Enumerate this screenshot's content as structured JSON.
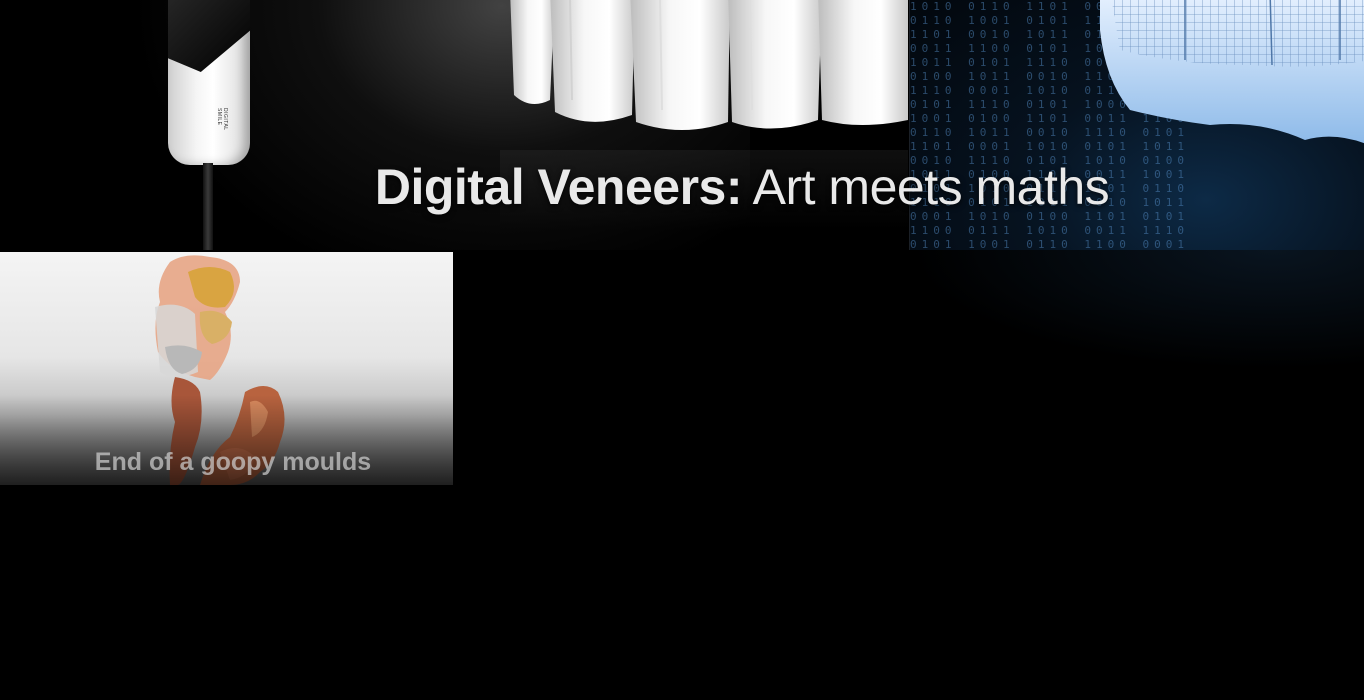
{
  "banner": {
    "title_bold": "Digital Veneers:",
    "title_regular": " Art meets maths",
    "scanner_logo": "DIGITAL SMILE",
    "binary_text": "1010 0110 1101 0011 1001\n0110 1001 0101 1100 0111\n1101 0010 1011 0110 1001\n0011 1100 0101 1010 0110\n1011 0101 1110 0001 1011\n0100 1011 0010 1101 0100\n1110 0001 1010 0111 1101\n0101 1110 0101 1000 0010\n1001 0100 1101 0011 1100\n0110 1011 0010 1110 0101\n1101 0001 1010 0101 1011\n0010 1110 0101 1010 0100\n1011 0100 1101 0011 1001\n0101 1010 0110 1101 0110\n1110 0101 1011 0010 1011\n0001 1010 0100 1101 0101\n1100 0111 1010 0011 1110\n0101 1001 0110 1100 0001"
  },
  "thumbnail": {
    "caption": "End of a goopy moulds"
  },
  "colors": {
    "background": "#000000",
    "title_text": "#e9e9e9",
    "digital_blue": "#0d2a46",
    "mould_orange": "#e07a5f",
    "mould_gold": "#d9a441"
  }
}
